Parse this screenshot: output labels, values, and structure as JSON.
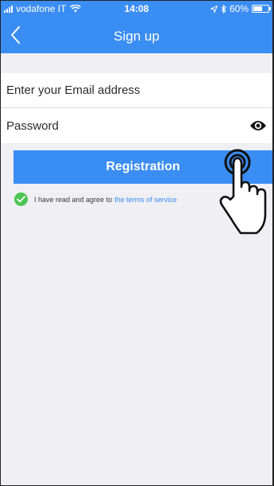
{
  "status_bar": {
    "carrier": "vodafone IT",
    "time": "14:08",
    "battery": "60%",
    "battery_level": 0.6
  },
  "nav": {
    "title": "Sign up",
    "back_icon": "chevron-left-icon"
  },
  "form": {
    "email_placeholder": "Enter your Email address",
    "password_placeholder": "Password",
    "password_toggle_icon": "eye-icon"
  },
  "register_button": {
    "label": "Registration"
  },
  "agreement": {
    "text": "I have read and agree to",
    "link": "the terms of service",
    "checked": true
  },
  "colors": {
    "brand": "#3a8df2",
    "check": "#4cc552",
    "background": "#efeff4"
  }
}
